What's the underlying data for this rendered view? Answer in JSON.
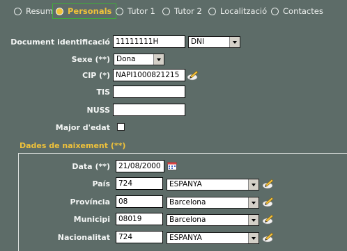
{
  "tabs": [
    {
      "label": "Resum",
      "active": false
    },
    {
      "label": "Personals",
      "active": true
    },
    {
      "label": "Tutor 1",
      "active": false
    },
    {
      "label": "Tutor 2",
      "active": false
    },
    {
      "label": "Localització",
      "active": false
    },
    {
      "label": "Contactes",
      "active": false
    }
  ],
  "personal": {
    "doc_label": "Document identificació",
    "doc_value": "11111111H",
    "doc_type": "DNI",
    "sex_label": "Sexe (**)",
    "sex_value": "Dona",
    "cip_label": "CIP (*)",
    "cip_value": "NAPI1000821215",
    "tis_label": "TIS",
    "tis_value": "",
    "nuss_label": "NUSS",
    "nuss_value": "",
    "adult_label": "Major d'edat",
    "adult_checked": false
  },
  "birth": {
    "section_title": "Dades de naixement (**)",
    "date_label": "Data (**)",
    "date_value": "21/08/2000",
    "country_label": "País",
    "country_code": "724",
    "country_name": "ESPANYA",
    "province_label": "Província",
    "province_code": "08",
    "province_name": "Barcelona",
    "municipality_label": "Municipi",
    "municipality_code": "08019",
    "municipality_name": "Barcelona",
    "nationality_label": "Nacionalitat",
    "nationality_code": "724",
    "nationality_name": "ESPANYA"
  },
  "colors": {
    "background": "#5d6c68",
    "accent": "#f0c23a",
    "active_tab_border": "#3fae3a"
  }
}
